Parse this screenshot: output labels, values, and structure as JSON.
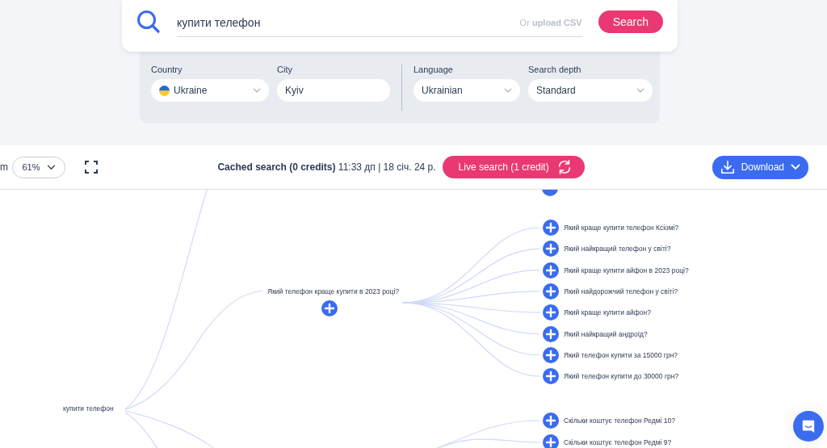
{
  "search": {
    "value": "купити телефон",
    "upload_prefix": "Or",
    "upload_link": "upload CSV",
    "button": "Search"
  },
  "filters": [
    {
      "label": "Country",
      "value": "Ukraine",
      "kind": "flag-select"
    },
    {
      "label": "City",
      "value": "Kyiv",
      "kind": "text"
    },
    {
      "label": "Language",
      "value": "Ukrainian",
      "kind": "select"
    },
    {
      "label": "Search depth",
      "value": "Standard",
      "kind": "select"
    }
  ],
  "toolbar": {
    "zoom_label_fragment": "m",
    "zoom": "61%",
    "cache_status": "Cached search (0 credits)",
    "cache_time": "11:33 дп | 18 січ. 24 р.",
    "live_button": "Live search (1 credit)",
    "download_button": "Download"
  },
  "mind_map": {
    "root": "купити телефон",
    "branches": [
      {
        "label": "Який телефон краще купити в 2023 році?",
        "children": [
          {
            "label": "Який краще купити телефон Ксіомі?"
          },
          {
            "label": "Який найкращий телефон у світі?"
          },
          {
            "label": "Який краще купити айфон в 2023 році?"
          },
          {
            "label": "Який найдорожчий телефон у світі?"
          },
          {
            "label": "Який краще купити айфон?"
          },
          {
            "label": "Який найкращий андроїд?"
          },
          {
            "label": "Який телефон купити за 15000 грн?"
          },
          {
            "label": "Який телефон купити до 30000 грн?"
          }
        ]
      },
      {
        "children": [
          {
            "label": "Скільки коштує телефон Редмі 10?"
          },
          {
            "label": "Скільки коштує телефон Редмі 9?"
          }
        ]
      }
    ]
  }
}
